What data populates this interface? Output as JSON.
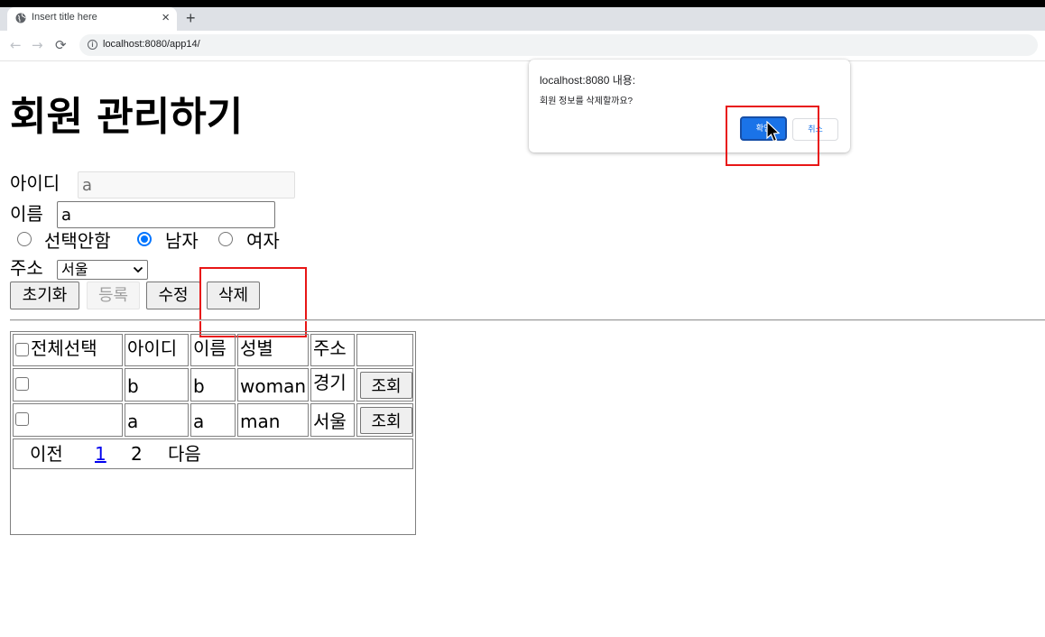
{
  "browser": {
    "tab_title": "Insert title here",
    "tab_close": "×",
    "new_tab": "+",
    "url": "localhost:8080/app14/",
    "back_glyph": "←",
    "forward_glyph": "→",
    "reload_glyph": "⟳",
    "info_glyph": "i"
  },
  "page": {
    "title": "회원 관리하기",
    "form": {
      "id_label": "아이디",
      "id_value": "a",
      "name_label": "이름",
      "name_value": "a",
      "gender_options": [
        "선택안함",
        "남자",
        "여자"
      ],
      "gender_selected": "남자",
      "addr_label": "주소",
      "addr_value": "서울"
    },
    "buttons": {
      "reset": "초기화",
      "register": "등록",
      "edit": "수정",
      "delete": "삭제"
    },
    "table": {
      "headers": [
        "전체선택",
        "아이디",
        "이름",
        "성별",
        "주소",
        ""
      ],
      "rows": [
        {
          "id": "b",
          "name": "b",
          "gender": "woman",
          "addr": "경기",
          "action": "조회"
        },
        {
          "id": "a",
          "name": "a",
          "gender": "man",
          "addr": "서울",
          "action": "조회"
        }
      ],
      "pagination": {
        "prev": "이전",
        "pages": [
          "1",
          "2"
        ],
        "next": "다음"
      }
    }
  },
  "dialog": {
    "title": "localhost:8080 내용:",
    "message": "회원 정보를 삭제할까요?",
    "confirm": "확인",
    "cancel": "취소"
  },
  "colors": {
    "highlight": "#e81616",
    "primary": "#1a73e8",
    "radio_checked": "#0075ff",
    "link": "#0000ee"
  },
  "icons": {
    "favicon": "globe-icon",
    "dropdown": "chevron-down-icon",
    "cursor": "mouse-pointer-icon"
  }
}
